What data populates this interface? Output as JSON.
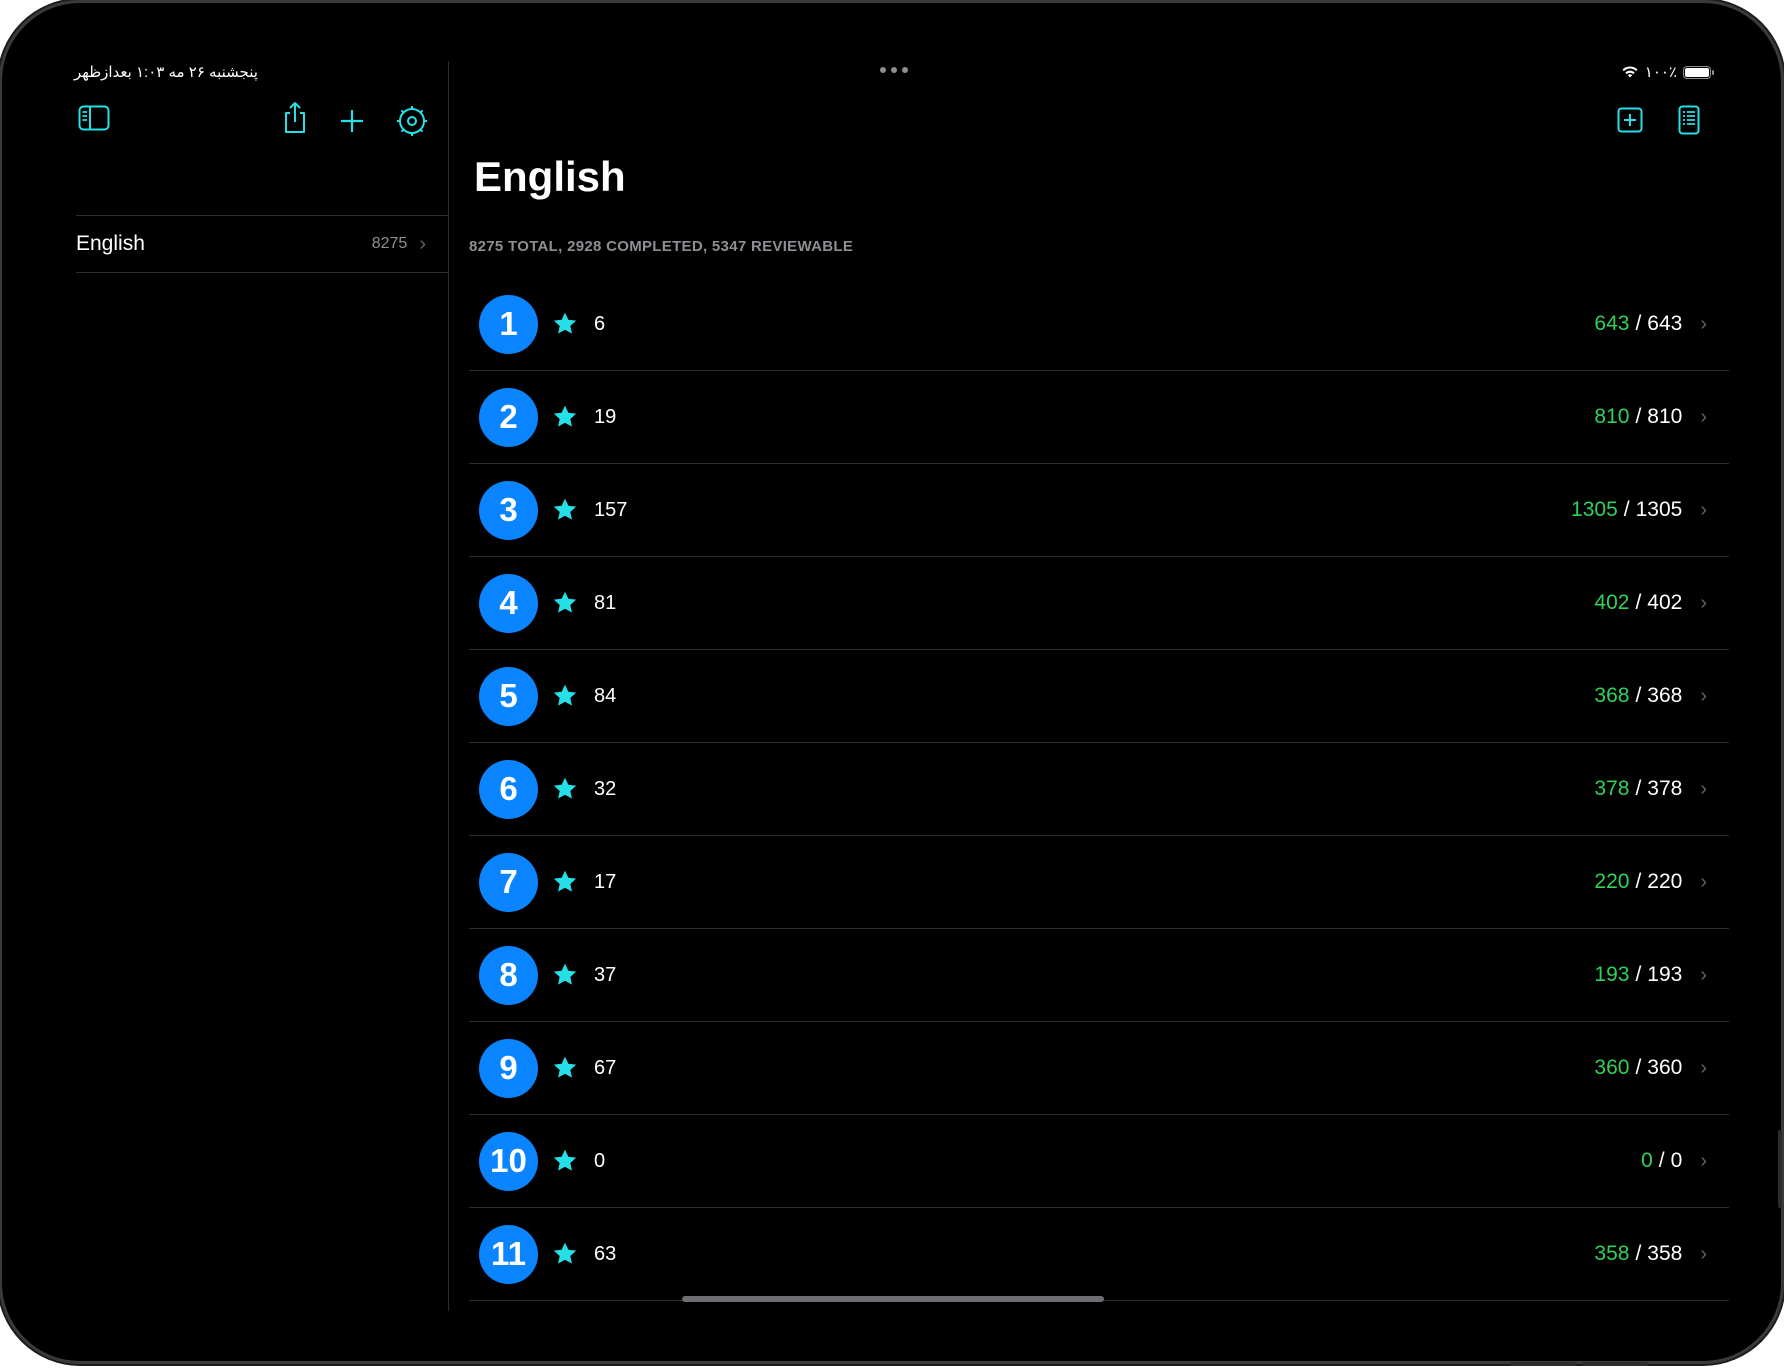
{
  "status_bar": {
    "datetime": "پنجشنبه ۲۶ مه   ۱:۰۳ بعدازظهر",
    "battery": "۱۰۰٪"
  },
  "sidebar": {
    "items": [
      {
        "label": "English",
        "count": "8275"
      }
    ]
  },
  "main": {
    "title": "English",
    "summary": "8275 TOTAL, 2928 COMPLETED, 5347 REVIEWABLE",
    "rows": [
      {
        "level": "1",
        "stars": "6",
        "done": "643",
        "total": "643"
      },
      {
        "level": "2",
        "stars": "19",
        "done": "810",
        "total": "810"
      },
      {
        "level": "3",
        "stars": "157",
        "done": "1305",
        "total": "1305"
      },
      {
        "level": "4",
        "stars": "81",
        "done": "402",
        "total": "402"
      },
      {
        "level": "5",
        "stars": "84",
        "done": "368",
        "total": "368"
      },
      {
        "level": "6",
        "stars": "32",
        "done": "378",
        "total": "378"
      },
      {
        "level": "7",
        "stars": "17",
        "done": "220",
        "total": "220"
      },
      {
        "level": "8",
        "stars": "37",
        "done": "193",
        "total": "193"
      },
      {
        "level": "9",
        "stars": "67",
        "done": "360",
        "total": "360"
      },
      {
        "level": "10",
        "stars": "0",
        "done": "0",
        "total": "0"
      },
      {
        "level": "11",
        "stars": "63",
        "done": "358",
        "total": "358"
      }
    ],
    "separator": "/"
  },
  "colors": {
    "accent": "#25e0e6",
    "badge": "#0a84ff",
    "completed": "#30d158"
  }
}
